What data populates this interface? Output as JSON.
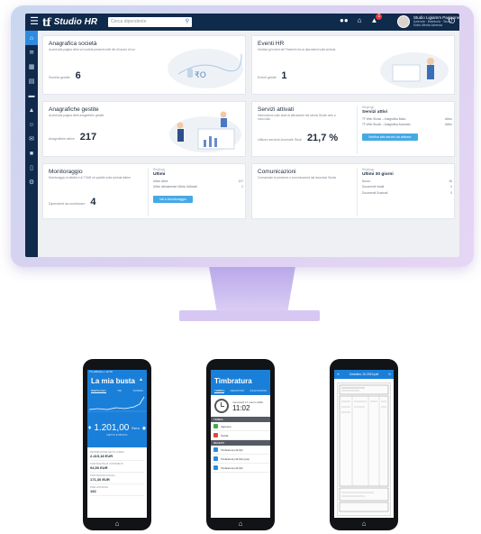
{
  "app": {
    "logo": "tf",
    "name": "Studio HR"
  },
  "topbar": {
    "search_placeholder": "Cerca dipendente",
    "user_name": "Studio Ligiamm Paginone...",
    "user_sub": "Azienda · Matricola · Studio",
    "user_sub2": "Sotto Media Azienda",
    "notif_count": "1"
  },
  "sidebar": {
    "items": [
      "home-icon",
      "users-icon",
      "file-icon",
      "document-icon",
      "card-icon",
      "org-chart-icon",
      "person-icon",
      "chat-icon",
      "folder-icon",
      "mail-icon",
      "settings-icon"
    ]
  },
  "cards": {
    "anagrafica_societa": {
      "title": "Anagrafica società",
      "desc": "Accedi alla pagina delle sei società presenti nelle lite di lavoro di cui.",
      "metric_label": "Società gestite",
      "metric_value": "6"
    },
    "eventi_hr": {
      "title": "Eventi HR",
      "desc": "Gestisci gli eventi dei Presenti che ai dipendenti sulla scheda.",
      "metric_label": "Eventi gestiti",
      "metric_value": "1"
    },
    "anagrafiche_gestite": {
      "title": "Anagrafiche gestite",
      "desc": "Accedi alla pagina delle anagrafiche gestite",
      "metric_label": "Anagrafiche attive",
      "metric_value": "217"
    },
    "servizi_attivati": {
      "title": "Servizi attivati",
      "desc": "Informazioni sullo stato di attivazione dei servizi Studio web a nuovi dati.",
      "metric_label": "Utilizzo servizio Anomale Studi",
      "metric_value": "21,7 %",
      "panel_label": "Riepilogo",
      "panel_title": "Servizi attivi",
      "rows": [
        [
          "TF Web Studio – Anagrafica Basic",
          "Attivo"
        ],
        [
          "TF Web Studio – Anagrafica Avanzato",
          "Attivo"
        ]
      ],
      "button": "Verifica altri servizi da attivare"
    },
    "monitoraggio": {
      "title": "Monitoraggio",
      "desc": "Monitoraggio di attività e di TSAB né spedite sulla scheda lettere",
      "metric_label": "Dipendenti da monitorare",
      "metric_value": "4",
      "panel_label": "Riepilogo",
      "panel_title": "Ultimi",
      "rows": [
        [
          "Ultimi ultimi",
          "107"
        ],
        [
          "Ultimi ultimamente Ultimo Utilizzati",
          "2"
        ]
      ],
      "button": "Vai a Monitoraggio"
    },
    "comunicazioni": {
      "title": "Comunicazioni",
      "desc": "Comunicate le presenze e comunicazioni dai lavoratori Studio",
      "panel_label": "Riepilogo",
      "panel_title": "Ultimi 30 giorni",
      "rows": [
        [
          "Nuovo",
          "36"
        ],
        [
          "Documenti inviati",
          "0"
        ],
        [
          "Documenti Scaricati",
          "0"
        ]
      ]
    }
  },
  "phones": {
    "busta": {
      "status": "Tf LaBusta  ••  12:10",
      "title": "La mia busta",
      "tabs": [
        "RIEPILOGO",
        "TRI",
        "SOMMA"
      ],
      "amount": "1.201,00",
      "currency": "Euro",
      "amount_sub": "NETTO IN BUSTA",
      "rows": [
        {
          "label": "RETRIBUZIONE NETTA LORDA",
          "value": "2.415,18 EUR"
        },
        {
          "label": "TRATTENUTE DI CONTRIBUTI",
          "value": "94,50 EUR"
        },
        {
          "label": "TRATTENUTE FISCALI",
          "value": "171,30 EUR"
        },
        {
          "label": "ORE LAVORATE",
          "value": "152"
        }
      ]
    },
    "timbratura": {
      "title": "Timbratura",
      "tabs": [
        "TIMBRA",
        "REGISTRO",
        "RILEVAZIONI"
      ],
      "date": "mercoledì 17 marzo 2020",
      "time": "11:02",
      "section1": "TIMBRA",
      "items1": [
        "Ingresso",
        "Uscita"
      ],
      "section2": "RECENTI",
      "items2": [
        "Timbratura (11:02)",
        "Timbratura (11:02) (ora)",
        "Timbratura (11:02)"
      ]
    },
    "cedolino": {
      "header": "Cedolino 10-2019.pdf"
    }
  },
  "colors": {
    "nav": "#102a4c",
    "accent": "#2f8be0",
    "mobile_blue": "#1a7fd8",
    "button": "#45a9e6"
  }
}
